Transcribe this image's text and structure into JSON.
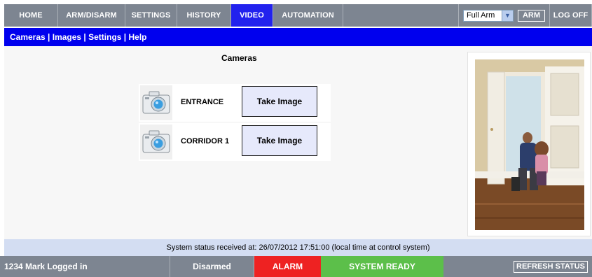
{
  "nav": {
    "tabs": [
      {
        "label": "HOME"
      },
      {
        "label": "ARM/DISARM"
      },
      {
        "label": "SETTINGS"
      },
      {
        "label": "HISTORY"
      },
      {
        "label": "VIDEO",
        "active": true
      },
      {
        "label": "AUTOMATION"
      }
    ],
    "arm_mode": {
      "selected": "Full Arm",
      "icon": "chevron-down-icon"
    },
    "arm_label": "ARM",
    "logoff_label": "LOG OFF"
  },
  "subnav": {
    "items": [
      "Cameras",
      "Images",
      "Settings",
      "Help"
    ],
    "separator": " | "
  },
  "main": {
    "title": "Cameras",
    "cameras": [
      {
        "name": "ENTRANCE",
        "button": "Take Image",
        "icon": "camera-icon"
      },
      {
        "name": "CORRIDOR 1",
        "button": "Take Image",
        "icon": "camera-icon"
      }
    ],
    "photo": {
      "description": "man and child embracing at front door"
    }
  },
  "status": {
    "text": "System status received at: 26/07/2012 17:51:00 (local time at control system)"
  },
  "footer": {
    "user": "1234 Mark Logged in",
    "arm_state": "Disarmed",
    "alarm": "ALARM",
    "system": "SYSTEM READY",
    "refresh": "REFRESH STATUS"
  },
  "colors": {
    "nav_gray": "#7d8591",
    "active_blue": "#2222ee",
    "subnav_blue": "#0000ee",
    "status_bg": "#d3ddf2",
    "alarm_red": "#ee2222",
    "ready_green": "#5cbf4a",
    "button_bg": "#e6e9fb"
  }
}
